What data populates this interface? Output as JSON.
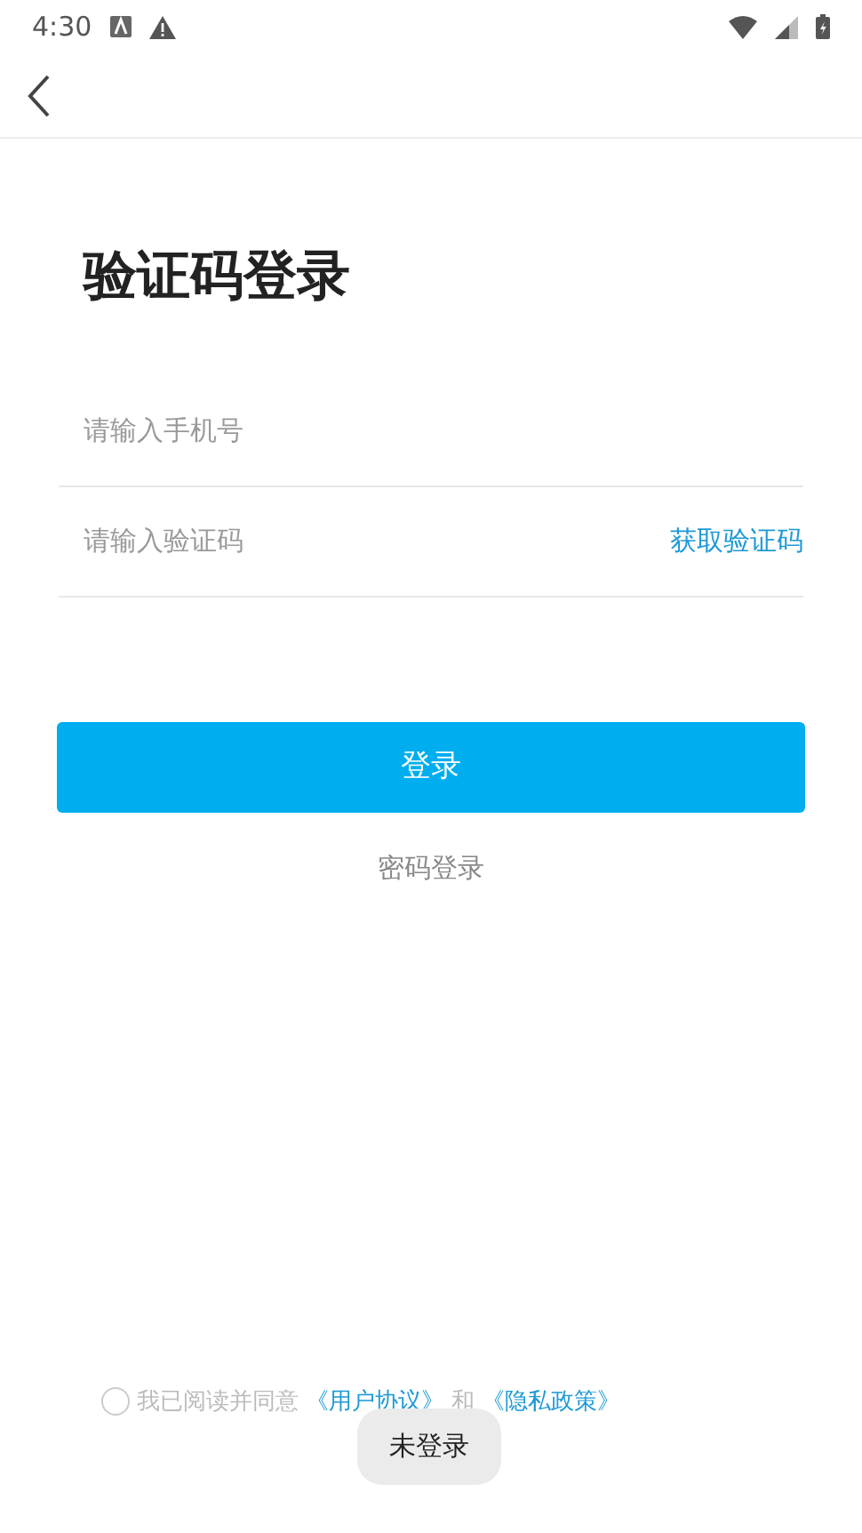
{
  "status_bar": {
    "time": "4:30"
  },
  "title": "验证码登录",
  "fields": [
    {
      "placeholder": "请输入手机号"
    },
    {
      "placeholder": "请输入验证码",
      "action": "获取验证码"
    }
  ],
  "login_button": "登录",
  "alt_login": "密码登录",
  "agreement": {
    "agreed": false,
    "parts": [
      {
        "kind": "text",
        "text": "我已阅读并同意"
      },
      {
        "kind": "link",
        "text": "《用户协议》"
      },
      {
        "kind": "text",
        "text": "和"
      },
      {
        "kind": "link",
        "text": "《隐私政策》"
      }
    ]
  },
  "toast": "未登录"
}
